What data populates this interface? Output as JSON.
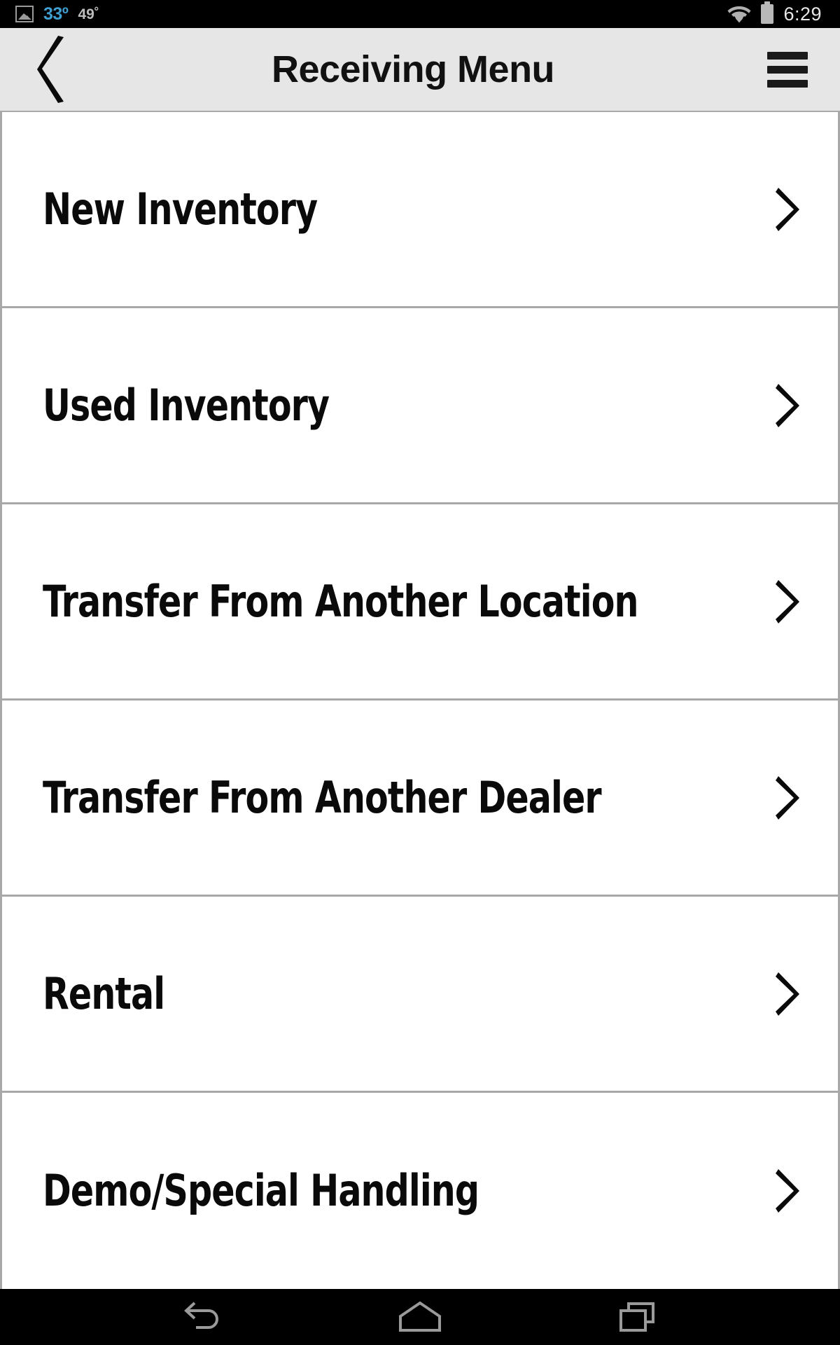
{
  "status_bar": {
    "weather_icon": "photo-icon",
    "temp_primary": "33º",
    "temp_secondary": "49˚",
    "wifi_icon": "wifi-icon",
    "battery_icon": "battery-icon",
    "clock": "6:29",
    "background_color": "#000000",
    "temp_primary_color": "#3F9FD0"
  },
  "header": {
    "back_icon": "chevron-left-icon",
    "title": "Receiving Menu",
    "menu_icon": "hamburger-menu-icon",
    "background_color": "#e6e6e6"
  },
  "menu": {
    "items": [
      {
        "label": "New Inventory",
        "chevron": "chevron-right-icon"
      },
      {
        "label": "Used Inventory",
        "chevron": "chevron-right-icon"
      },
      {
        "label": "Transfer From Another Location",
        "chevron": "chevron-right-icon"
      },
      {
        "label": "Transfer From Another Dealer",
        "chevron": "chevron-right-icon"
      },
      {
        "label": "Rental",
        "chevron": "chevron-right-icon"
      },
      {
        "label": "Demo/Special Handling",
        "chevron": "chevron-right-icon"
      }
    ],
    "divider_color": "#a8a8a8",
    "background_color": "#ffffff"
  },
  "nav_bar": {
    "back_icon": "android-back-icon",
    "home_icon": "android-home-icon",
    "recents_icon": "android-recents-icon",
    "background_color": "#000000",
    "icon_color": "#9a9a9a"
  }
}
